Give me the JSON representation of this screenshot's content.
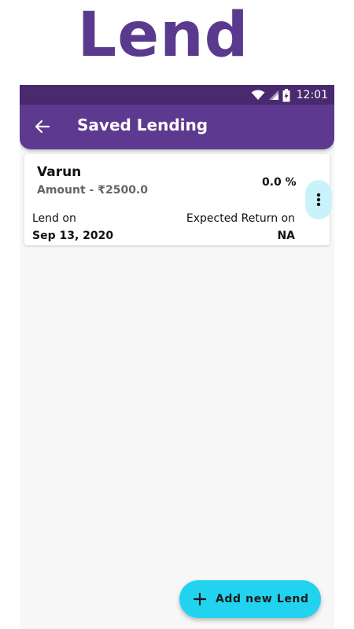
{
  "promo": {
    "title": "Lend"
  },
  "status_bar": {
    "time": "12:01",
    "icons": [
      "wifi-icon",
      "signal-icon",
      "battery-charging-icon"
    ]
  },
  "app_bar": {
    "title": "Saved Lending",
    "back_icon": "arrow-back-icon"
  },
  "lendings": [
    {
      "name": "Varun",
      "amount": "Amount - ₹2500.0",
      "rate": "0.0 %",
      "lend_on_label": "Lend on",
      "lend_on_date": "Sep 13, 2020",
      "return_label": "Expected Return on",
      "return_value": "NA",
      "menu_icon": "more-vert-icon"
    }
  ],
  "fab": {
    "label": "Add new Lend",
    "icon": "plus-icon"
  },
  "colors": {
    "primary": "#5d3a8f",
    "status_bar": "#4a2a6f",
    "accent": "#22d3f0",
    "menu_bg": "#c9f3fb"
  }
}
